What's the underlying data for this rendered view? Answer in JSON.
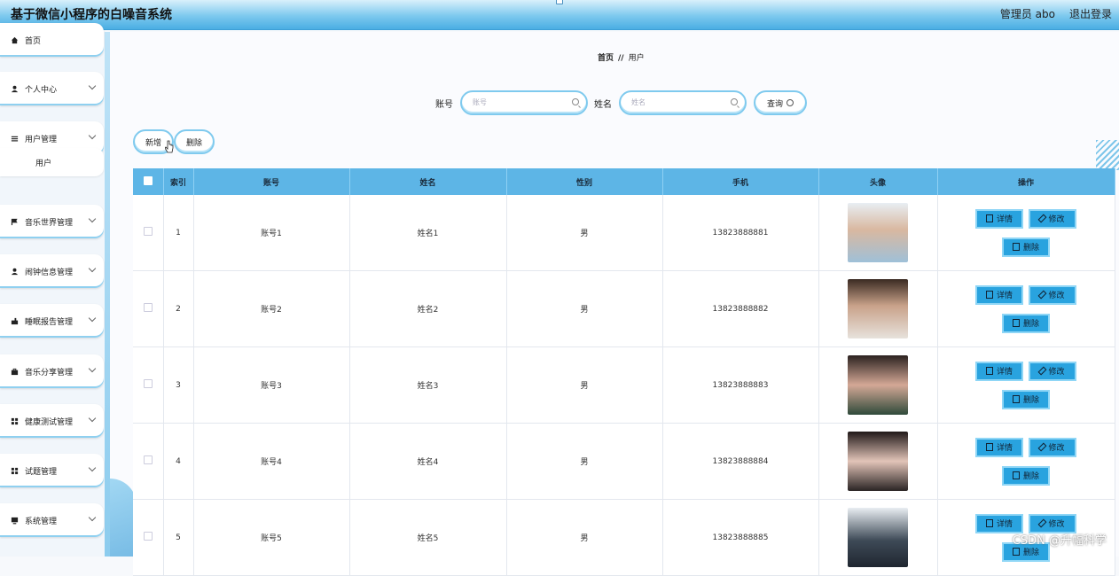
{
  "header": {
    "title": "基于微信小程序的白噪音系统",
    "admin": "管理员 abo",
    "logout": "退出登录"
  },
  "sidebar": {
    "items": [
      {
        "label": "首页",
        "icon": "home-icon",
        "has_children": false
      },
      {
        "label": "个人中心",
        "icon": "user-icon",
        "has_children": true
      },
      {
        "label": "用户管理",
        "icon": "list-icon",
        "has_children": true
      },
      {
        "label": "音乐世界管理",
        "icon": "flag-icon",
        "has_children": true
      },
      {
        "label": "闹钟信息管理",
        "icon": "user-icon",
        "has_children": true
      },
      {
        "label": "睡眠报告管理",
        "icon": "chart-icon",
        "has_children": true
      },
      {
        "label": "音乐分享管理",
        "icon": "briefcase-icon",
        "has_children": true
      },
      {
        "label": "健康测试管理",
        "icon": "grid-icon",
        "has_children": true
      },
      {
        "label": "试题管理",
        "icon": "grid-icon",
        "has_children": true
      },
      {
        "label": "系统管理",
        "icon": "monitor-icon",
        "has_children": true
      }
    ],
    "submenu": {
      "label": "用户"
    }
  },
  "breadcrumb": {
    "home": "首页",
    "sep": "//",
    "current": "用户"
  },
  "search": {
    "account_label": "账号",
    "account_placeholder": "账号",
    "name_label": "姓名",
    "name_placeholder": "姓名",
    "query_label": "查询"
  },
  "actions": {
    "add": "新增",
    "delete": "删除"
  },
  "table": {
    "headers": [
      "索引",
      "账号",
      "姓名",
      "性别",
      "手机",
      "头像",
      "操作"
    ],
    "rows": [
      {
        "index": "1",
        "account": "账号1",
        "name": "姓名1",
        "gender": "男",
        "phone": "13823888881"
      },
      {
        "index": "2",
        "account": "账号2",
        "name": "姓名2",
        "gender": "男",
        "phone": "13823888882"
      },
      {
        "index": "3",
        "account": "账号3",
        "name": "姓名3",
        "gender": "男",
        "phone": "13823888883"
      },
      {
        "index": "4",
        "account": "账号4",
        "name": "姓名4",
        "gender": "男",
        "phone": "13823888884"
      },
      {
        "index": "5",
        "account": "账号5",
        "name": "姓名5",
        "gender": "男",
        "phone": "13823888885"
      }
    ],
    "op_labels": {
      "detail": "详情",
      "edit": "修改",
      "delete": "删除"
    }
  },
  "watermark": "CSDN @升幅科学",
  "colors": {
    "accent": "#5db5e6",
    "button": "#29a3df",
    "header_gradient_end": "#4aaee3"
  }
}
